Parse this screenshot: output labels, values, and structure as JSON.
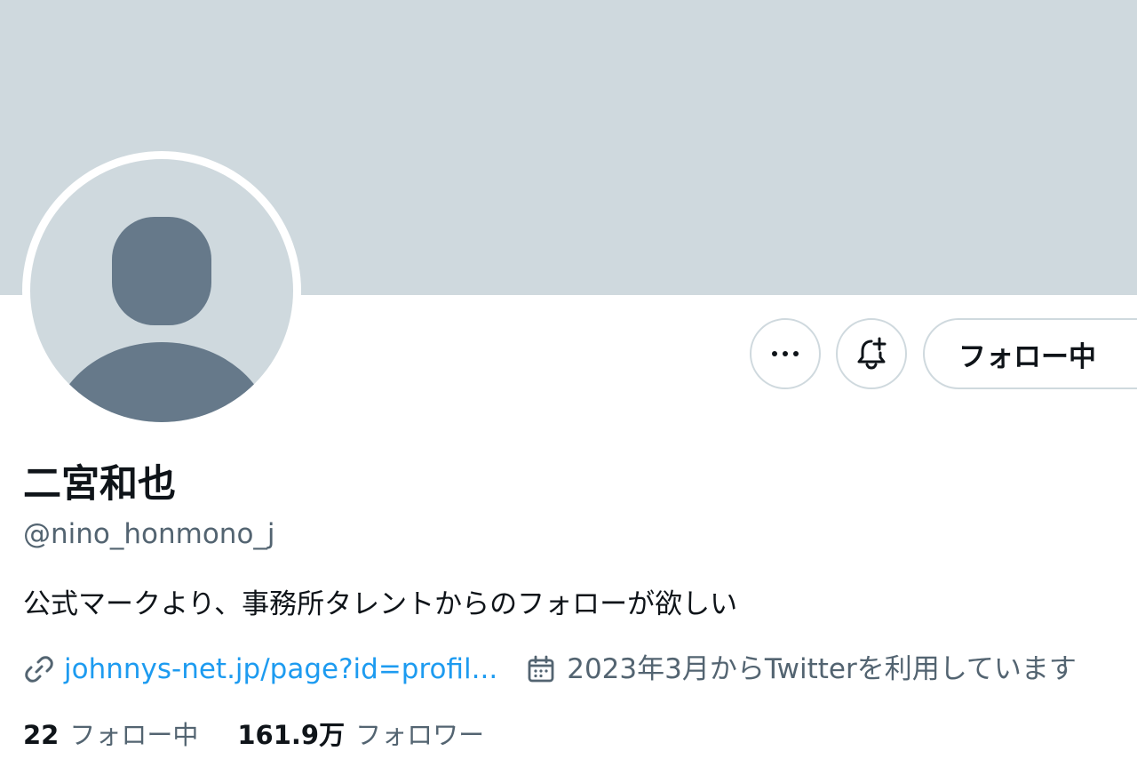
{
  "profile": {
    "display_name": "二宮和也",
    "handle": "@nino_honmono_j",
    "bio": "公式マークより、事務所タレントからのフォローが欲しい",
    "link": "johnnys-net.jp/page?id=profil...",
    "joined": "2023年3月からTwitterを利用しています"
  },
  "actions": {
    "more_icon": "more-horizontal-icon",
    "notify_icon": "bell-plus-icon",
    "following_label": "フォロー中"
  },
  "stats": {
    "following_count": "22",
    "following_label": "フォロー中",
    "followers_count": "161.9万",
    "followers_label": "フォロワー"
  },
  "icons": {
    "link": "link-icon",
    "calendar": "calendar-icon"
  },
  "colors": {
    "banner": "#cfd9de",
    "avatar_silhouette": "#66798a",
    "link": "#1d9bf0",
    "secondary_text": "#536471",
    "primary_text": "#0f1419"
  }
}
